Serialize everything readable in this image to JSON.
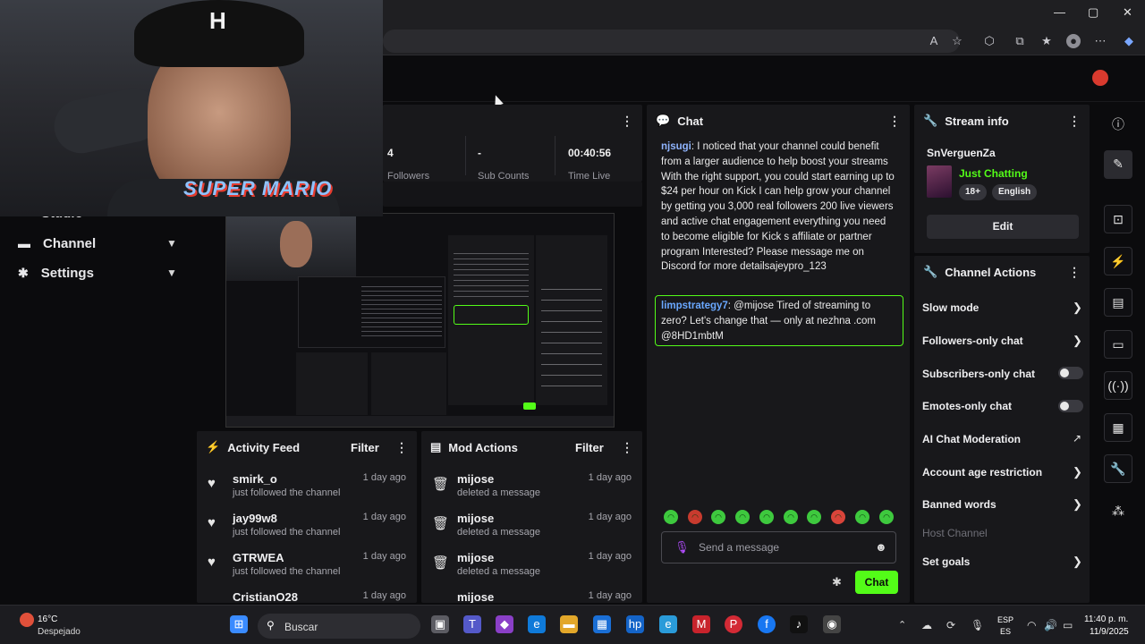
{
  "browser": {
    "window_controls": [
      "—",
      "▢",
      "✕"
    ]
  },
  "sidebar": {
    "items": [
      {
        "label": "Studio"
      },
      {
        "label": "Channel"
      },
      {
        "label": "Settings"
      }
    ]
  },
  "stats": {
    "followers_value": "4",
    "followers_label": "Followers",
    "subs_value": "-",
    "subs_label": "Sub Counts",
    "time_value": "00:40:56",
    "time_label": "Time Live"
  },
  "webcam": {
    "shirt_text": "SUPER MARIO"
  },
  "activity_feed": {
    "title": "Activity Feed",
    "filter": "Filter",
    "items": [
      {
        "name": "smirk_o",
        "action": "just followed the channel",
        "time": "1 day ago"
      },
      {
        "name": "jay99w8",
        "action": "just followed the channel",
        "time": "1 day ago"
      },
      {
        "name": "GTRWEA",
        "action": "just followed the channel",
        "time": "1 day ago"
      },
      {
        "name": "CristianO28",
        "action": "",
        "time": "1 day ago"
      }
    ]
  },
  "mod_actions": {
    "title": "Mod Actions",
    "filter": "Filter",
    "items": [
      {
        "name": "mijose",
        "action": "deleted a message",
        "time": "1 day ago"
      },
      {
        "name": "mijose",
        "action": "deleted a message",
        "time": "1 day ago"
      },
      {
        "name": "mijose",
        "action": "deleted a message",
        "time": "1 day ago"
      },
      {
        "name": "mijose",
        "action": "",
        "time": "1 day ago"
      }
    ]
  },
  "chat": {
    "title": "Chat",
    "messages": [
      {
        "user": "njsugi",
        "text": ": I noticed that your channel could benefit from a larger audience to help boost your streams With the right support, you could start earning up to $24 per hour on Kick I can help grow your channel by getting you 3,000 real followers 200 live viewers and active chat engagement everything you need to become eligible for Kick s affiliate or partner program Interested? Please message me on Discord for more detailsajeypro_123"
      },
      {
        "user": "limpstrategy7",
        "text": ": @mijose Tired of streaming to zero? Let's change that — only at nezhna .com @8HD1mbtM"
      }
    ],
    "input_placeholder": "Send a message",
    "send_label": "Chat"
  },
  "stream_info": {
    "title": "Stream info",
    "channel": "SnVerguenZa",
    "category": "Just Chatting",
    "tags": [
      "18+",
      "English"
    ],
    "edit_label": "Edit"
  },
  "channel_actions": {
    "title": "Channel Actions",
    "items": [
      {
        "label": "Slow mode",
        "control": "chevron"
      },
      {
        "label": "Followers-only chat",
        "control": "chevron"
      },
      {
        "label": "Subscribers-only chat",
        "control": "toggle"
      },
      {
        "label": "Emotes-only chat",
        "control": "toggle"
      },
      {
        "label": "AI Chat Moderation",
        "control": "external"
      },
      {
        "label": "Account age restriction",
        "control": "chevron"
      },
      {
        "label": "Banned words",
        "control": "chevron"
      },
      {
        "label": "Host Channel",
        "control": "none"
      },
      {
        "label": "Set goals",
        "control": "chevron"
      }
    ]
  },
  "taskbar": {
    "weather_temp": "16°C",
    "weather_desc": "Despejado",
    "search_label": "Buscar",
    "lang_1": "ESP",
    "lang_2": "ES",
    "time": "11:40 p. m.",
    "date": "11/9/2025"
  },
  "colors": {
    "accent": "#53fc18",
    "panel": "#18181b",
    "background": "#0b0b0d"
  }
}
